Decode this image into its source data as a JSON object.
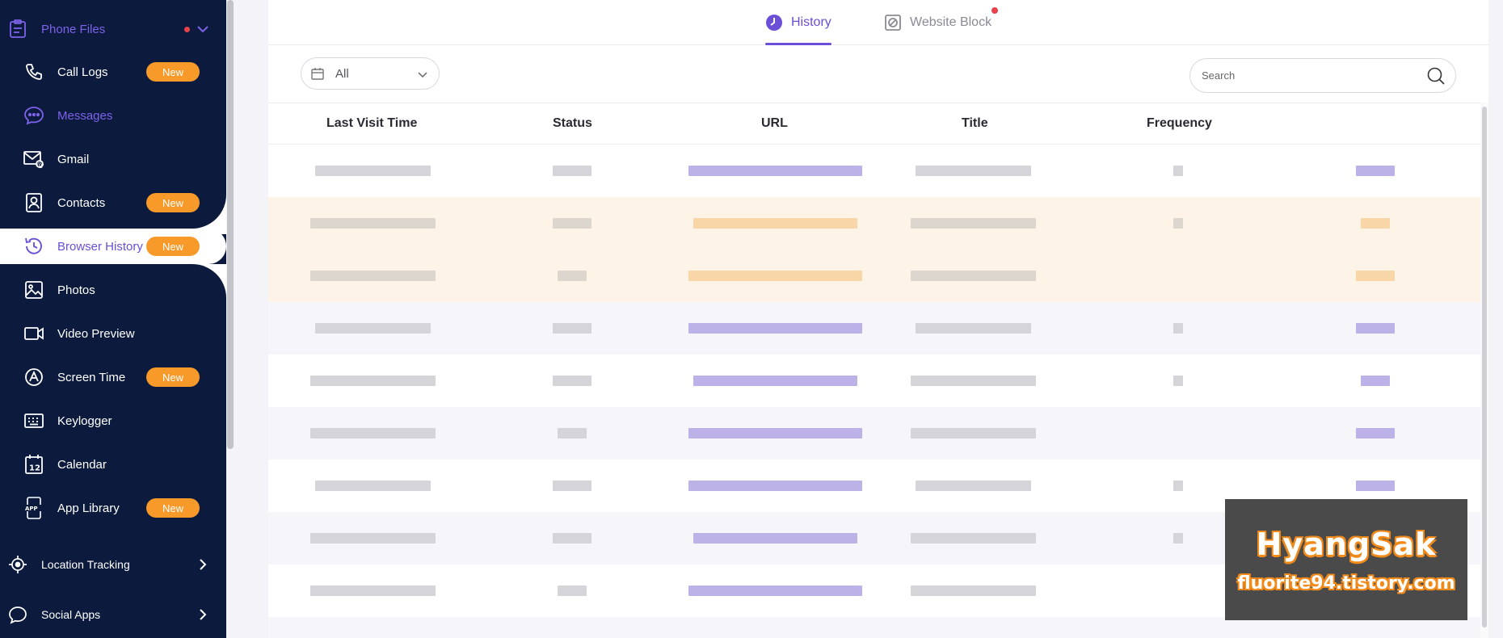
{
  "sidebar": {
    "phone_files": {
      "label": "Phone Files"
    },
    "items": [
      {
        "label": "Call Logs",
        "badge": "New"
      },
      {
        "label": "Messages"
      },
      {
        "label": "Gmail"
      },
      {
        "label": "Contacts",
        "badge": "New"
      },
      {
        "label": "Browser History",
        "badge": "New"
      },
      {
        "label": "Photos"
      },
      {
        "label": "Video Preview"
      },
      {
        "label": "Screen Time",
        "badge": "New"
      },
      {
        "label": "Keylogger"
      },
      {
        "label": "Calendar"
      },
      {
        "label": "App Library",
        "badge": "New"
      }
    ],
    "location_tracking": {
      "label": "Location Tracking"
    },
    "social_apps": {
      "label": "Social Apps"
    }
  },
  "tabs": {
    "history": "History",
    "website_block": "Website Block"
  },
  "filter": {
    "value": "All"
  },
  "search": {
    "placeholder": "Search"
  },
  "table": {
    "headers": {
      "last_visit_time": "Last Visit Time",
      "status": "Status",
      "url": "URL",
      "title": "Title",
      "frequency": "Frequency"
    }
  },
  "watermark": {
    "line1": "HyangSak",
    "line2": "fluorite94.tistory.com"
  },
  "colors": {
    "sidebar_bg": "#0c1b3d",
    "accent_purple": "#6b4fd6",
    "badge_orange": "#f79a29",
    "notify_red": "#e9414a",
    "highlight_row": "#fdf3e6"
  }
}
